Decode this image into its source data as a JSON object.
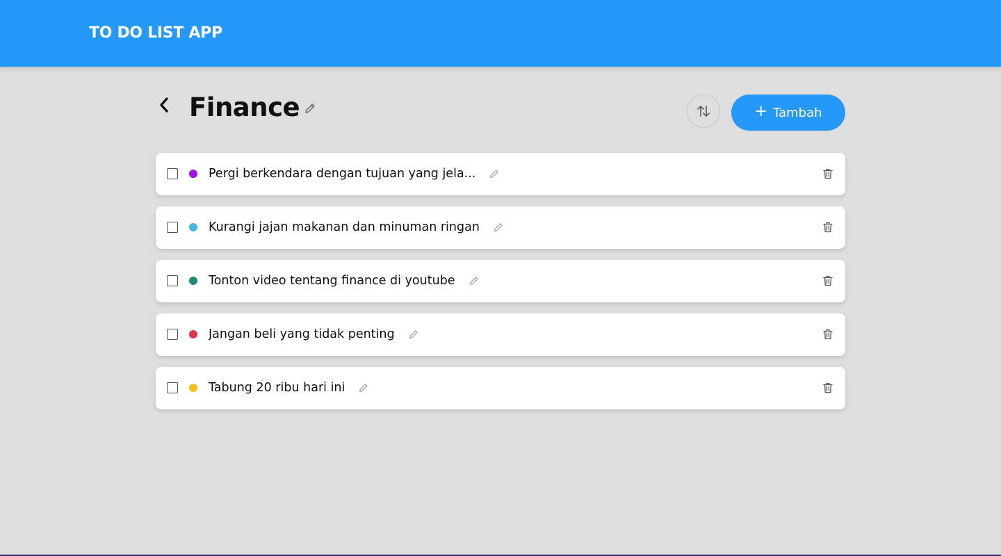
{
  "header": {
    "app_title": "TO DO LIST APP"
  },
  "colors": {
    "accent": "#2499fa",
    "background": "#dedede"
  },
  "page": {
    "title": "Finance",
    "back_icon": "chevron-left-icon",
    "title_edit_icon": "pencil-icon",
    "sort_icon": "sort-arrows-icon",
    "add_button": {
      "plus": "+",
      "label": "Tambah"
    }
  },
  "todos": [
    {
      "text": "Pergi berkendara dengan tujuan yang jela...",
      "color": "#9b10ef",
      "done": false
    },
    {
      "text": "Kurangi jajan makanan dan minuman ringan",
      "color": "#45b6dd",
      "done": false
    },
    {
      "text": "Tonton video tentang finance di youtube",
      "color": "#1b8b78",
      "done": false
    },
    {
      "text": "Jangan beli yang tidak penting",
      "color": "#e2344d",
      "done": false
    },
    {
      "text": "Tabung 20 ribu hari ini",
      "color": "#f3c018",
      "done": false
    }
  ]
}
